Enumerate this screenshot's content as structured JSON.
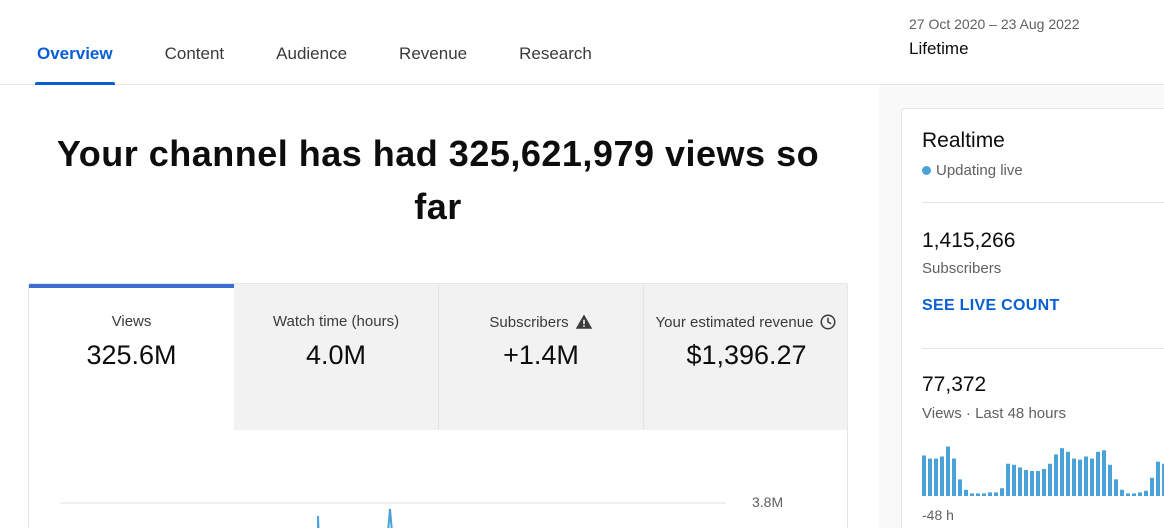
{
  "nav": {
    "tabs": [
      {
        "label": "Overview",
        "active": true
      },
      {
        "label": "Content",
        "active": false
      },
      {
        "label": "Audience",
        "active": false
      },
      {
        "label": "Revenue",
        "active": false
      },
      {
        "label": "Research",
        "active": false
      }
    ]
  },
  "date_range": {
    "dates": "27 Oct 2020 – 23 Aug 2022",
    "label": "Lifetime"
  },
  "headline": "Your channel has had 325,621,979 views so far",
  "metrics": [
    {
      "label": "Views",
      "value": "325.6M",
      "icon": null
    },
    {
      "label": "Watch time (hours)",
      "value": "4.0M",
      "icon": null
    },
    {
      "label": "Subscribers",
      "value": "+1.4M",
      "icon": "warning-icon"
    },
    {
      "label": "Your estimated revenue",
      "value": "$1,396.27",
      "icon": "clock-icon"
    }
  ],
  "main_chart": {
    "y_tick_label": "3.8M"
  },
  "realtime": {
    "title": "Realtime",
    "live_text": "Updating live",
    "subscribers_value": "1,415,266",
    "subscribers_label": "Subscribers",
    "live_count_link": "SEE LIVE COUNT",
    "views_value": "77,372",
    "views_label": "Views · Last 48 hours",
    "axis_start": "-48 h",
    "bar_color": "#4aa3d8",
    "bars": [
      0.78,
      0.72,
      0.72,
      0.76,
      0.95,
      0.72,
      0.32,
      0.12,
      0.05,
      0.05,
      0.05,
      0.07,
      0.07,
      0.15,
      0.62,
      0.6,
      0.55,
      0.5,
      0.48,
      0.48,
      0.52,
      0.62,
      0.8,
      0.92,
      0.85,
      0.72,
      0.7,
      0.76,
      0.72,
      0.85,
      0.88,
      0.6,
      0.32,
      0.12,
      0.05,
      0.05,
      0.07,
      0.1,
      0.35,
      0.66,
      0.62,
      0.55
    ]
  },
  "colors": {
    "accent": "#065fd4",
    "active_metric_bar": "#3a6fd1",
    "chart_line": "#4aa3d8"
  }
}
